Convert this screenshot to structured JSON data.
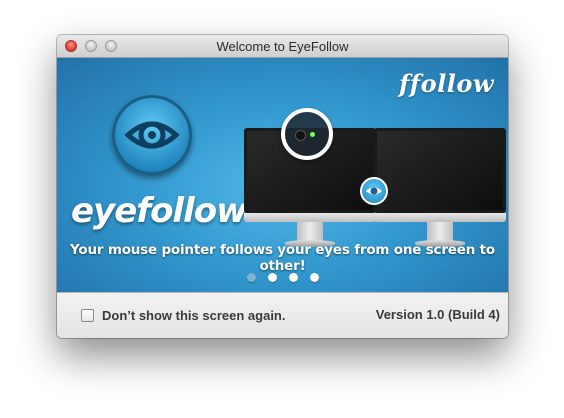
{
  "window": {
    "title": "Welcome to EyeFollow"
  },
  "banner": {
    "brand_small": "ffollow",
    "brand_big": "eyefollow",
    "tagline": "Your mouse pointer follows your eyes from one screen to other!",
    "page_dots": {
      "count": 4,
      "active_index": 0
    }
  },
  "footer": {
    "checkbox_label": "Don’t show this screen again.",
    "checkbox_checked": false,
    "version": "Version 1.0 (Build 4)"
  },
  "colors": {
    "banner_blue": "#2f97cf",
    "close_button": "#d63b2f"
  },
  "icons": [
    "close-button",
    "minimize-button",
    "zoom-button",
    "eye-logo-icon",
    "webcam-icon",
    "eye-badge-icon"
  ]
}
